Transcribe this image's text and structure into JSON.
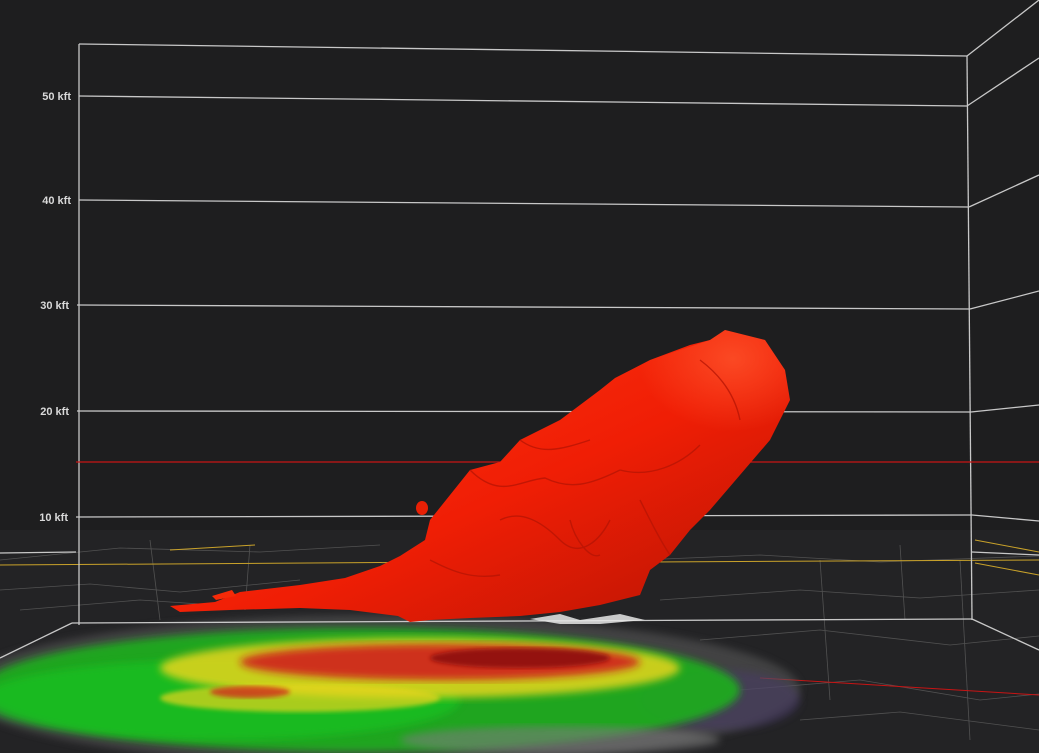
{
  "view": {
    "type": "3D radar volume",
    "altitude_unit": "kft"
  },
  "altitude_labels": [
    {
      "key": "alt-10",
      "text": "10 kft"
    },
    {
      "key": "alt-20",
      "text": "20 kft"
    },
    {
      "key": "alt-30",
      "text": "30 kft"
    },
    {
      "key": "alt-40",
      "text": "40 kft"
    },
    {
      "key": "alt-50",
      "text": "50 kft"
    }
  ],
  "colors": {
    "background": "#1e1e1f",
    "grid_lines": "#c8c8c8",
    "reference_line": "#c81414",
    "isosurface": "#f01e05",
    "isosurface_shadow": "#a81003",
    "county_lines": "#6a6a6a",
    "state_lines": "#c9a22a",
    "reflectivity_light": "#1fb01c",
    "reflectivity_moderate": "#e6d51c",
    "reflectivity_heavy": "#d0141a",
    "reflectivity_weak": "#7a7a7a"
  }
}
